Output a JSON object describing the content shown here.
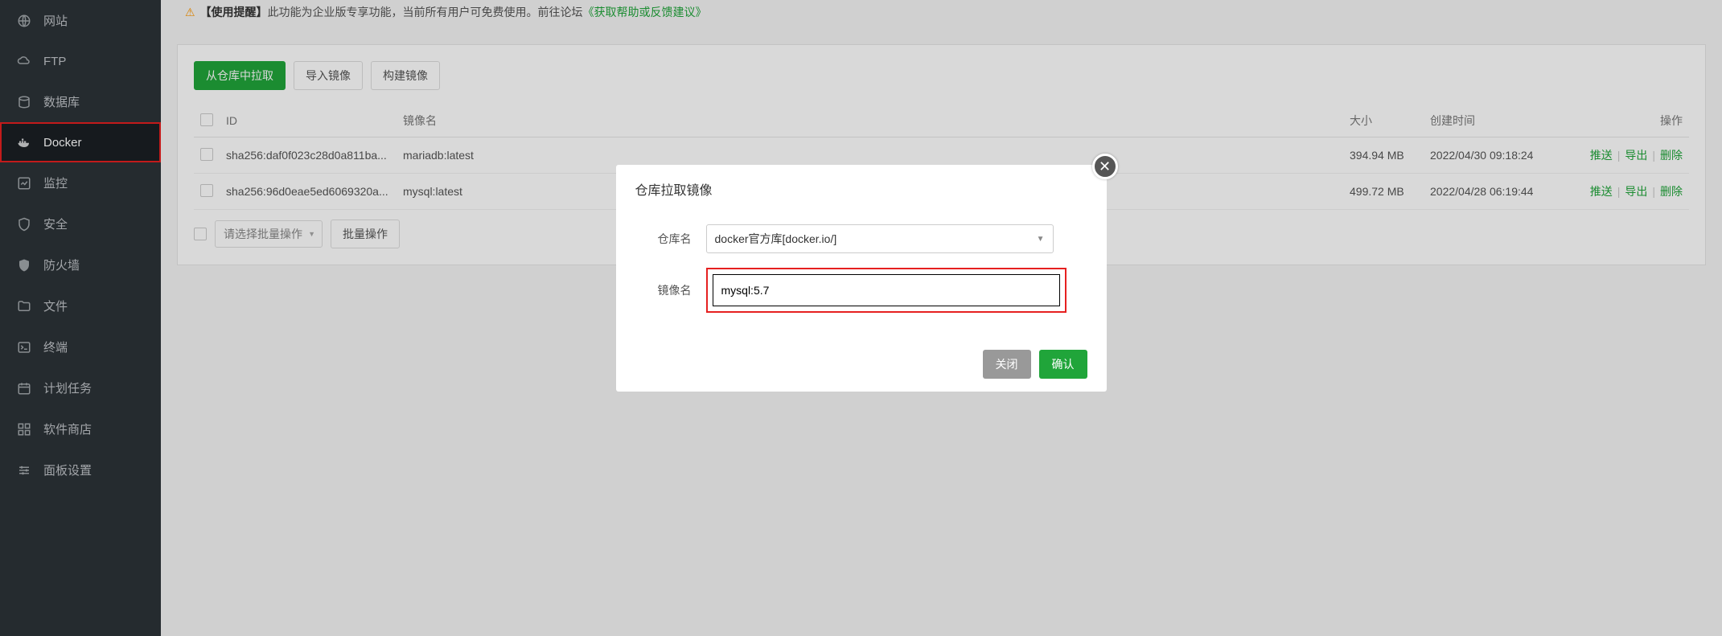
{
  "sidebar": {
    "items": [
      {
        "label": "网站",
        "icon": "globe"
      },
      {
        "label": "FTP",
        "icon": "cloud"
      },
      {
        "label": "数据库",
        "icon": "database"
      },
      {
        "label": "Docker",
        "icon": "docker",
        "active": true
      },
      {
        "label": "监控",
        "icon": "chart"
      },
      {
        "label": "安全",
        "icon": "shield"
      },
      {
        "label": "防火墙",
        "icon": "firewall"
      },
      {
        "label": "文件",
        "icon": "folder"
      },
      {
        "label": "终端",
        "icon": "terminal"
      },
      {
        "label": "计划任务",
        "icon": "calendar"
      },
      {
        "label": "软件商店",
        "icon": "apps"
      },
      {
        "label": "面板设置",
        "icon": "settings"
      }
    ]
  },
  "tip": {
    "prefix": "【使用提醒】",
    "text": "此功能为企业版专享功能，当前所有用户可免费使用。前往论坛",
    "link": "《获取帮助或反馈建议》"
  },
  "toolbar": {
    "pull_label": "从仓库中拉取",
    "import_label": "导入镜像",
    "build_label": "构建镜像"
  },
  "table": {
    "headers": {
      "id": "ID",
      "name": "镜像名",
      "size": "大小",
      "created": "创建时间",
      "action": "操作"
    },
    "rows": [
      {
        "id": "sha256:daf0f023c28d0a811ba...",
        "name": "mariadb:latest",
        "size": "394.94 MB",
        "created": "2022/04/30 09:18:24"
      },
      {
        "id": "sha256:96d0eae5ed6069320a...",
        "name": "mysql:latest",
        "size": "499.72 MB",
        "created": "2022/04/28 06:19:44"
      }
    ],
    "actions": {
      "push": "推送",
      "export": "导出",
      "delete": "删除"
    }
  },
  "batch": {
    "placeholder": "请选择批量操作",
    "exec_label": "批量操作"
  },
  "dialog": {
    "title": "仓库拉取镜像",
    "repo_label": "仓库名",
    "repo_value": "docker官方库[docker.io/]",
    "image_label": "镜像名",
    "image_value": "mysql:5.7",
    "close": "关闭",
    "confirm": "确认"
  }
}
